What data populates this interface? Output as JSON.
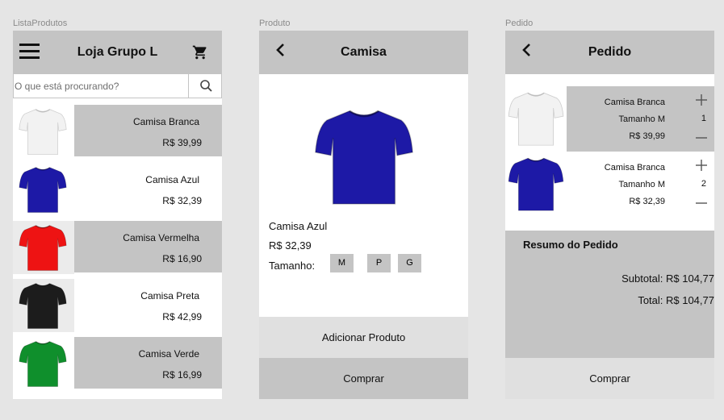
{
  "frames": {
    "lista_label": "ListaProdutos",
    "produto_label": "Produto",
    "pedido_label": "Pedido"
  },
  "lista": {
    "title": "Loja Grupo L",
    "search_placeholder": "O que está procurando?",
    "items": [
      {
        "name": "Camisa Branca",
        "price": "R$ 39,99",
        "color": "#f2f2f2"
      },
      {
        "name": "Camisa Azul",
        "price": "R$ 32,39",
        "color": "#1d19a6"
      },
      {
        "name": "Camisa Vermelha",
        "price": "R$ 16,90",
        "color": "#ee1313"
      },
      {
        "name": "Camisa Preta",
        "price": "R$ 42,99",
        "color": "#1c1c1c"
      },
      {
        "name": "Camisa Verde",
        "price": "R$ 16,99",
        "color": "#0f8f2c"
      }
    ]
  },
  "produto": {
    "title": "Camisa",
    "name": "Camisa Azul",
    "price": "R$ 32,39",
    "size_label": "Tamanho:",
    "sizes": [
      "M",
      "P",
      "G"
    ],
    "add_button": "Adicionar Produto",
    "buy_button": "Comprar",
    "color": "#1d19a6"
  },
  "pedido": {
    "title": "Pedido",
    "items": [
      {
        "name": "Camisa Branca",
        "size": "Tamanho M",
        "price": "R$ 39,99",
        "qty": "1",
        "color": "#f2f2f2"
      },
      {
        "name": "Camisa Branca",
        "size": "Tamanho M",
        "price": "R$ 32,39",
        "qty": "2",
        "color": "#1d19a6"
      }
    ],
    "summary_title": "Resumo do Pedido",
    "subtotal": "Subtotal: R$ 104,77",
    "total": "Total: R$ 104,77",
    "buy_button": "Comprar"
  },
  "colors": {
    "header_grey": "#c4c4c4",
    "button_light": "#e0e0e0",
    "canvas": "#e5e5e5"
  }
}
